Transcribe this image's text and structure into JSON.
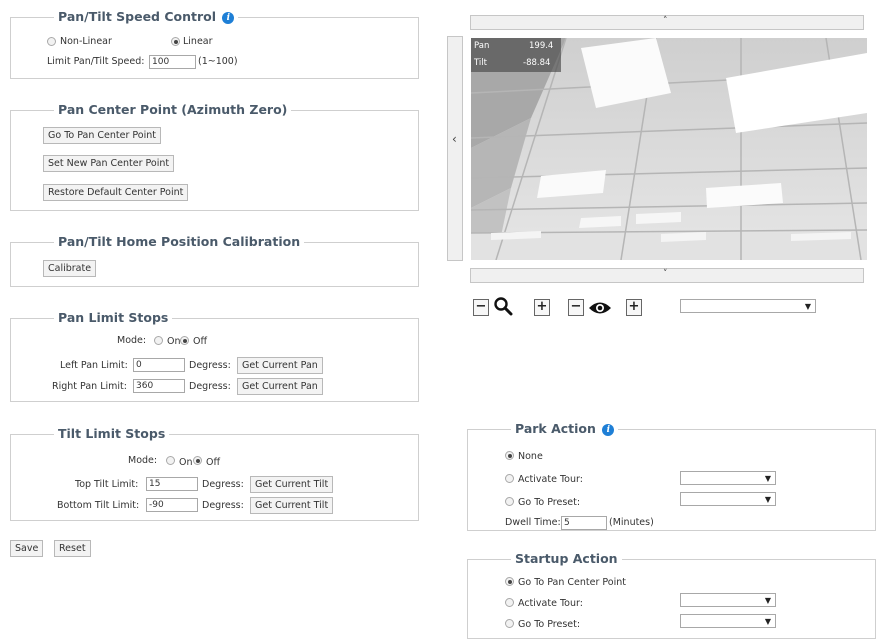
{
  "speed_control": {
    "title": "Pan/Tilt Speed Control",
    "mode_options": [
      "Non-Linear",
      "Linear"
    ],
    "selected_mode": "Linear",
    "limit_label": "Limit Pan/Tilt Speed:",
    "limit_value": "100",
    "limit_range": "(1~100)"
  },
  "pan_center": {
    "title": "Pan Center Point (Azimuth Zero)",
    "buttons": [
      "Go To Pan Center Point",
      "Set New Pan Center Point",
      "Restore Default Center Point"
    ]
  },
  "home_calibration": {
    "title": "Pan/Tilt Home Position Calibration",
    "button": "Calibrate"
  },
  "pan_limit": {
    "title": "Pan Limit Stops",
    "mode_label": "Mode:",
    "mode_options": [
      "On",
      "Off"
    ],
    "selected_mode": "Off",
    "left_label": "Left Pan Limit:",
    "left_value": "0",
    "right_label": "Right Pan Limit:",
    "right_value": "360",
    "units": "Degress:",
    "get_button": "Get Current Pan"
  },
  "tilt_limit": {
    "title": "Tilt Limit Stops",
    "mode_label": "Mode:",
    "mode_options": [
      "On",
      "Off"
    ],
    "selected_mode": "Off",
    "top_label": "Top Tilt Limit:",
    "top_value": "15",
    "bottom_label": "Bottom Tilt Limit:",
    "bottom_value": "-90",
    "units": "Degress:",
    "get_button": "Get Current Tilt"
  },
  "footer": {
    "save": "Save",
    "reset": "Reset"
  },
  "camera": {
    "pan_label": "Pan",
    "pan_value": "199.4",
    "tilt_label": "Tilt",
    "tilt_value": "-88.84",
    "up_arrow": "˄",
    "down_arrow": "˅",
    "left_arrow": "‹",
    "minus": "−",
    "plus": "+"
  },
  "park_action": {
    "title": "Park Action",
    "options": [
      "None",
      "Activate Tour:",
      "Go To Preset:"
    ],
    "selected": "None",
    "dwell_label": "Dwell Time:",
    "dwell_value": "5",
    "dwell_units": "(Minutes)"
  },
  "startup_action": {
    "title": "Startup Action",
    "options": [
      "Go To Pan Center Point",
      "Activate Tour:",
      "Go To Preset:"
    ],
    "selected": "Go To Pan Center Point"
  },
  "colors": {
    "accent": "#1e7fd6",
    "legend": "#4a5a6a"
  }
}
